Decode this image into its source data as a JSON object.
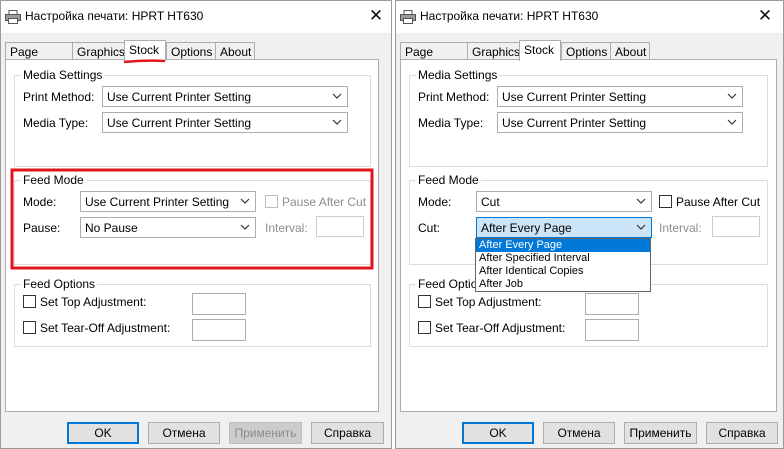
{
  "colors": {
    "accent": "#0078d7",
    "annotation": "#e0161c"
  },
  "left": {
    "title": "Настройка печати: HPRT HT630",
    "tabs": [
      "Page Setup",
      "Graphics",
      "Stock",
      "Options",
      "About"
    ],
    "active_tab": "Stock",
    "media": {
      "group": "Media Settings",
      "print_method_label": "Print Method:",
      "print_method_value": "Use Current Printer Setting",
      "media_type_label": "Media Type:",
      "media_type_value": "Use Current Printer Setting"
    },
    "feed": {
      "group": "Feed Mode",
      "mode_label": "Mode:",
      "mode_value": "Use Current Printer Setting",
      "pause_after_cut": "Pause After Cut",
      "pause_label": "Pause:",
      "pause_value": "No Pause",
      "interval_label": "Interval:"
    },
    "options": {
      "group": "Feed Options",
      "top_adjust": "Set Top Adjustment:",
      "tearoff_adjust": "Set Tear-Off Adjustment:"
    },
    "buttons": {
      "ok": "OK",
      "cancel": "Отмена",
      "apply": "Применить",
      "help": "Справка"
    }
  },
  "right": {
    "title": "Настройка печати: HPRT HT630",
    "tabs": [
      "Page Setup",
      "Graphics",
      "Stock",
      "Options",
      "About"
    ],
    "active_tab": "Stock",
    "media": {
      "group": "Media Settings",
      "print_method_label": "Print Method:",
      "print_method_value": "Use Current Printer Setting",
      "media_type_label": "Media Type:",
      "media_type_value": "Use Current Printer Setting"
    },
    "feed": {
      "group": "Feed Mode",
      "mode_label": "Mode:",
      "mode_value": "Cut",
      "pause_after_cut": "Pause After Cut",
      "cut_label": "Cut:",
      "cut_value": "After Every Page",
      "interval_label": "Interval:",
      "cut_options": [
        "After Every Page",
        "After Specified Interval",
        "After Identical Copies",
        "After Job"
      ]
    },
    "options": {
      "group": "Feed Options",
      "top_adjust": "Set Top Adjustment:",
      "tearoff_adjust": "Set Tear-Off Adjustment:"
    },
    "buttons": {
      "ok": "OK",
      "cancel": "Отмена",
      "apply": "Применить",
      "help": "Справка"
    }
  }
}
